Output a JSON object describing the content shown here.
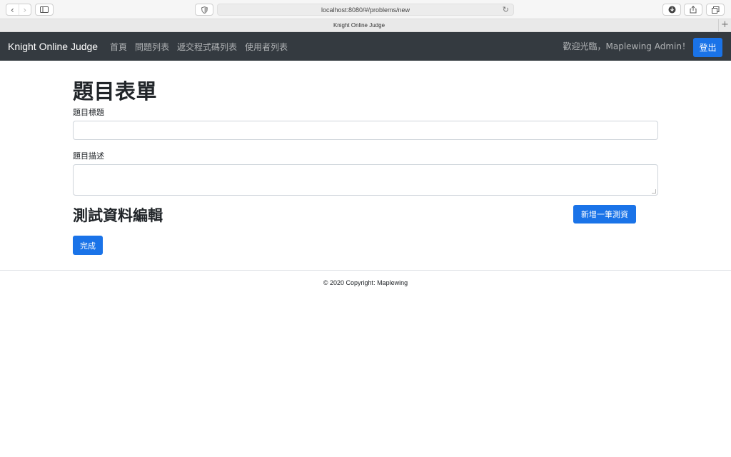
{
  "browser": {
    "url": "localhost:8080/#/problems/new",
    "tab_title": "Knight Online Judge",
    "back_icon": "chevron-left-icon",
    "forward_icon": "chevron-right-icon",
    "new_tab_symbol": "+"
  },
  "navbar": {
    "brand": "Knight Online Judge",
    "links": [
      "首頁",
      "問題列表",
      "遞交程式碼列表",
      "使用者列表"
    ],
    "welcome": "歡迎光臨，Maplewing Admin！",
    "logout_label": "登出"
  },
  "form": {
    "title": "題目表單",
    "title_field_label": "題目標題",
    "title_field_value": "",
    "description_label": "題目描述",
    "description_value": "",
    "testdata_heading": "測試資料編輯",
    "add_testdata_label": "新增一筆測資",
    "done_label": "完成"
  },
  "footer": {
    "text": "© 2020 Copyright: Maplewing"
  },
  "colors": {
    "primary": "#1a73e8",
    "navbar_bg": "#343a40"
  }
}
